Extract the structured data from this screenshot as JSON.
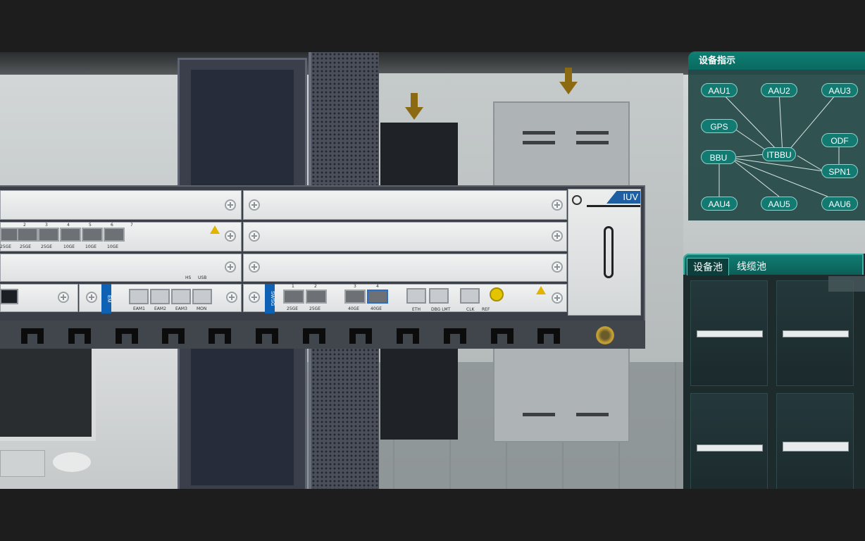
{
  "indicator_panel": {
    "title": "设备指示",
    "nodes": [
      "AAU1",
      "AAU2",
      "AAU3",
      "GPS",
      "ODF",
      "BBU",
      "ITBBU",
      "SPN1",
      "AAU4",
      "AAU5",
      "AAU6"
    ]
  },
  "pool_panel": {
    "tabs": [
      "设备池",
      "线缆池"
    ]
  },
  "chassis": {
    "brand_logo": "IUV",
    "em_tag": "EM",
    "swsg_tag": "SWSG",
    "board_ports_top": [
      "2",
      "3",
      "4",
      "5",
      "6",
      "7"
    ],
    "board_port_labels": [
      "25GE",
      "25GE",
      "25GE",
      "10GE",
      "10GE",
      "10GE"
    ],
    "small_labels": [
      "HS",
      "USB"
    ],
    "em_ports": [
      "EAM1",
      "EAM2",
      "EAM3",
      "MON"
    ],
    "swsg_port_numbers": [
      "1",
      "2",
      "3",
      "4"
    ],
    "swsg_port_labels": [
      "25GE",
      "25GE",
      "40GE",
      "40GE"
    ],
    "swsg_rj45": [
      "ETH",
      "DBG LMT",
      "CLK",
      "REF"
    ]
  },
  "colors": {
    "panel_teal": "#0e7f74",
    "node_teal": "#137a72",
    "em_blue": "#0e61b3",
    "warning_yellow": "#e2b400"
  }
}
